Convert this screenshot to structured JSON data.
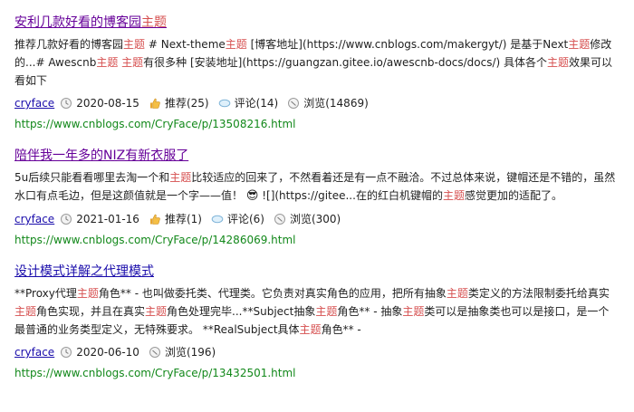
{
  "colors": {
    "title_link": "#1a0dab",
    "title_link_visited": "#660099",
    "highlight": "#d64f4f",
    "url": "#12881a",
    "text": "#1f1f1f"
  },
  "results": [
    {
      "title_pre": "安利几款好看的博客园",
      "title_hl": "主题",
      "title_post": "",
      "title_color": "#660099",
      "summary_segments": [
        {
          "t": "推荐几款好看的博客园",
          "hl": false
        },
        {
          "t": "主题",
          "hl": true
        },
        {
          "t": " # Next-theme",
          "hl": false
        },
        {
          "t": "主题",
          "hl": true
        },
        {
          "t": " [博客地址](https://www.cnblogs.com/makergyt/) 是基于Next",
          "hl": false
        },
        {
          "t": "主题",
          "hl": true
        },
        {
          "t": "修改的...# Awescnb",
          "hl": false
        },
        {
          "t": "主题",
          "hl": true
        },
        {
          "t": " ",
          "hl": false
        },
        {
          "t": "主题",
          "hl": true
        },
        {
          "t": "有很多种 [安装地址](https://guangzan.gitee.io/awescnb-docs/docs/) 具体各个",
          "hl": false
        },
        {
          "t": "主题",
          "hl": true
        },
        {
          "t": "效果可以看如下",
          "hl": false
        }
      ],
      "author": "cryface",
      "date": "2020-08-15",
      "recommend": "推荐(25)",
      "comments": "评论(14)",
      "views": "浏览(14869)",
      "url": "https://www.cnblogs.com/CryFace/p/13508216.html"
    },
    {
      "title_pre": "陪伴我一年多的NIZ有新衣服了",
      "title_hl": "",
      "title_post": "",
      "title_color": "#660099",
      "summary_segments": [
        {
          "t": "5u后续只能看看哪里去淘一个和",
          "hl": false
        },
        {
          "t": "主题",
          "hl": true
        },
        {
          "t": "比较适应的回来了，不然看着还是有一点不融洽。不过总体来说，键帽还是不错的，虽然水口有点毛边，但是这颜值就是一个字——值！ ",
          "hl": false
        },
        {
          "t": "😎",
          "hl": false,
          "emoji": true
        },
        {
          "t": " ![](https://gitee...在的红白机键帽的",
          "hl": false
        },
        {
          "t": "主题",
          "hl": true
        },
        {
          "t": "感觉更加的适配了。",
          "hl": false
        }
      ],
      "author": "cryface",
      "date": "2021-01-16",
      "recommend": "推荐(1)",
      "comments": "评论(6)",
      "views": "浏览(300)",
      "url": "https://www.cnblogs.com/CryFace/p/14286069.html"
    },
    {
      "title_pre": "设计模式详解之代理模式",
      "title_hl": "",
      "title_post": "",
      "title_color": "#1a0dab",
      "summary_segments": [
        {
          "t": "**Proxy代理",
          "hl": false
        },
        {
          "t": "主题",
          "hl": true
        },
        {
          "t": "角色** - 也叫做委托类、代理类。它负责对真实角色的应用，把所有抽象",
          "hl": false
        },
        {
          "t": "主题",
          "hl": true
        },
        {
          "t": "类定义的方法限制委托给真实",
          "hl": false
        },
        {
          "t": "主题",
          "hl": true
        },
        {
          "t": "角色实现，并且在真实",
          "hl": false
        },
        {
          "t": "主题",
          "hl": true
        },
        {
          "t": "角色处理完毕...**Subject抽象",
          "hl": false
        },
        {
          "t": "主题",
          "hl": true
        },
        {
          "t": "角色** - 抽象",
          "hl": false
        },
        {
          "t": "主题",
          "hl": true
        },
        {
          "t": "类可以是抽象类也可以是接口，是一个最普通的业务类型定义，无特殊要求。 **RealSubject具体",
          "hl": false
        },
        {
          "t": "主题",
          "hl": true
        },
        {
          "t": "角色** -",
          "hl": false
        }
      ],
      "author": "cryface",
      "date": "2020-06-10",
      "recommend": "",
      "comments": "",
      "views": "浏览(196)",
      "url": "https://www.cnblogs.com/CryFace/p/13432501.html"
    }
  ]
}
